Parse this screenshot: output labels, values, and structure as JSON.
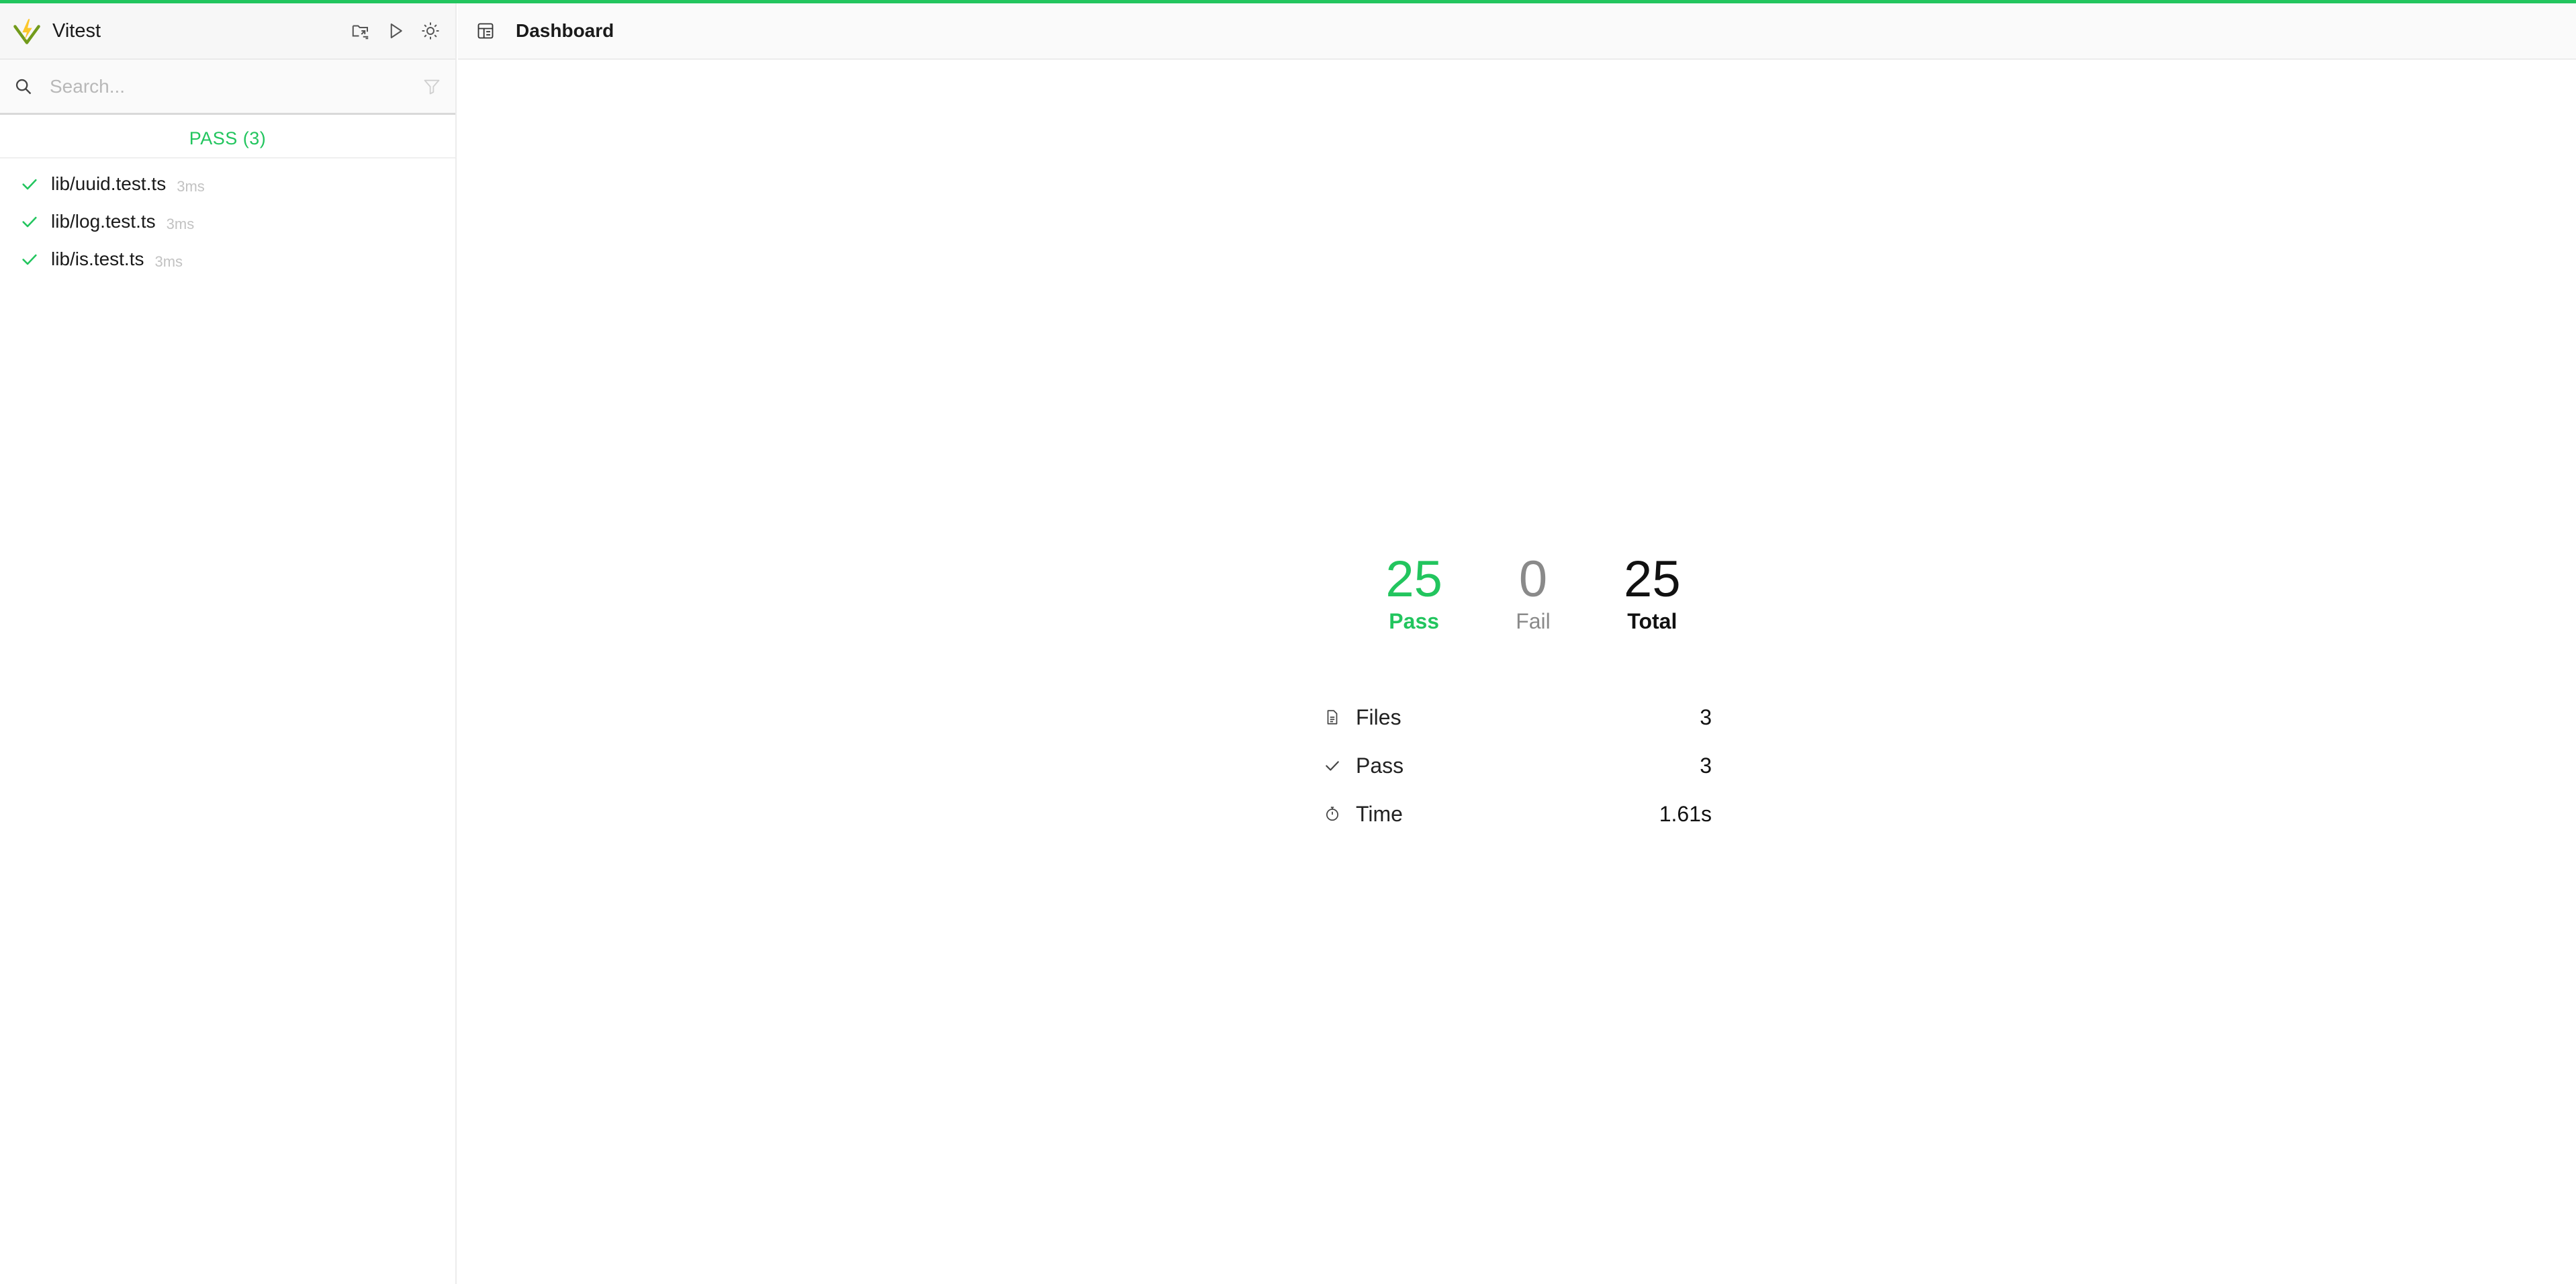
{
  "app": {
    "title": "Vitest"
  },
  "colors": {
    "accent": "#22c55e",
    "fail": "#8a8a8a",
    "muted": "#c2c2c2"
  },
  "header_icons": [
    "show-in-explorer-icon",
    "run-icon",
    "theme-toggle-icon"
  ],
  "search": {
    "placeholder": "Search...",
    "value": ""
  },
  "group": {
    "title": "PASS (3)"
  },
  "files": [
    {
      "name": "lib/uuid.test.ts",
      "duration": "3ms",
      "status": "pass"
    },
    {
      "name": "lib/log.test.ts",
      "duration": "3ms",
      "status": "pass"
    },
    {
      "name": "lib/is.test.ts",
      "duration": "3ms",
      "status": "pass"
    }
  ],
  "main": {
    "title": "Dashboard"
  },
  "counters": {
    "pass": {
      "value": "25",
      "label": "Pass"
    },
    "fail": {
      "value": "0",
      "label": "Fail"
    },
    "total": {
      "value": "25",
      "label": "Total"
    }
  },
  "summary": [
    {
      "icon": "file-icon",
      "label": "Files",
      "value": "3"
    },
    {
      "icon": "check-icon",
      "label": "Pass",
      "value": "3"
    },
    {
      "icon": "timer-icon",
      "label": "Time",
      "value": "1.61s"
    }
  ]
}
